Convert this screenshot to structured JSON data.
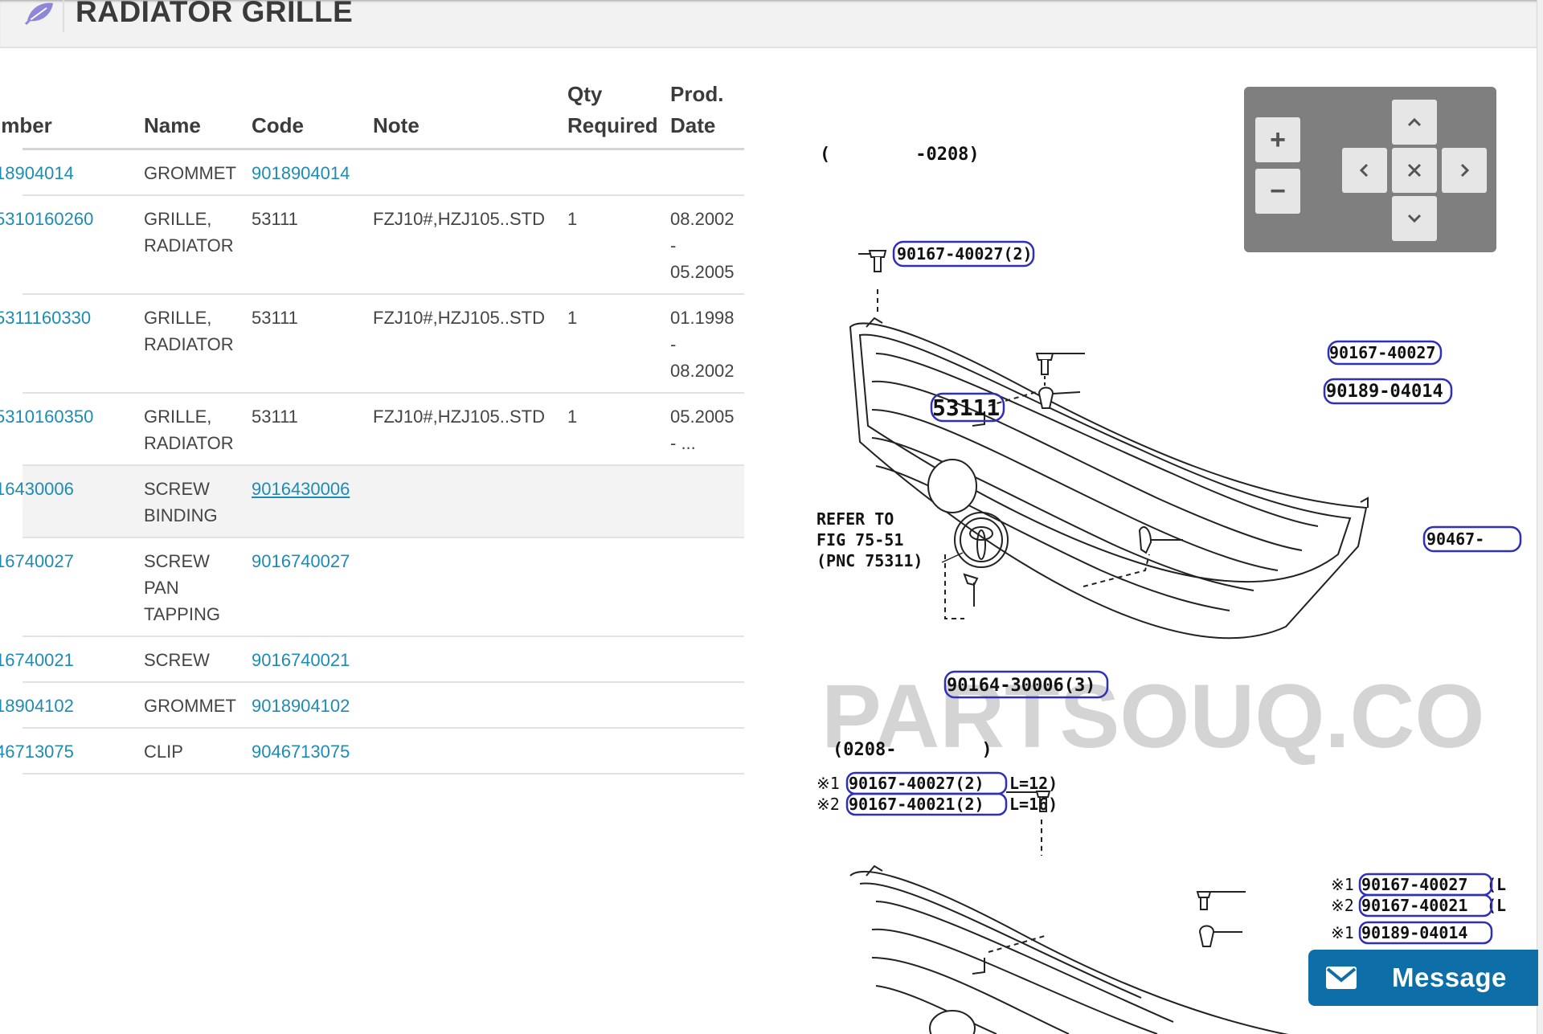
{
  "header": {
    "title": "RADIATOR GRILLE",
    "logo_icon": "leaf-logo-icon"
  },
  "table": {
    "headers": {
      "number": "ımber",
      "name": "Name",
      "code": "Code",
      "note": "Note",
      "qty_line1": "Qty",
      "qty_line2": "Required",
      "date_line1": "Prod.",
      "date_line2": "Date"
    },
    "rows": [
      {
        "number": "18904014",
        "name": [
          "GROMMET"
        ],
        "code": "9018904014",
        "code_is_link": true,
        "note": "",
        "qty": "",
        "date": []
      },
      {
        "number": "5310160260",
        "name": [
          "GRILLE,",
          "RADIATOR"
        ],
        "code": "53111",
        "code_is_link": false,
        "note": "FZJ10#,HZJ105..STD",
        "qty": "1",
        "date": [
          "08.2002",
          "-",
          "05.2005"
        ]
      },
      {
        "number": "5311160330",
        "name": [
          "GRILLE,",
          "RADIATOR"
        ],
        "code": "53111",
        "code_is_link": false,
        "note": "FZJ10#,HZJ105..STD",
        "qty": "1",
        "date": [
          "01.1998",
          "-",
          "08.2002"
        ]
      },
      {
        "number": "5310160350",
        "name": [
          "GRILLE,",
          "RADIATOR"
        ],
        "code": "53111",
        "code_is_link": false,
        "note": "FZJ10#,HZJ105..STD",
        "qty": "1",
        "date": [
          "05.2005",
          "- ..."
        ]
      },
      {
        "number": "16430006",
        "name": [
          "SCREW",
          "BINDING"
        ],
        "code": "9016430006",
        "code_is_link": true,
        "code_underlined": true,
        "highlighted": true,
        "note": "",
        "qty": "",
        "date": []
      },
      {
        "number": "16740027",
        "name": [
          "SCREW",
          "PAN",
          "TAPPING"
        ],
        "code": "9016740027",
        "code_is_link": true,
        "note": "",
        "qty": "",
        "date": []
      },
      {
        "number": "16740021",
        "name": [
          "SCREW"
        ],
        "code": "9016740021",
        "code_is_link": true,
        "note": "",
        "qty": "",
        "date": []
      },
      {
        "number": "18904102",
        "name": [
          "GROMMET"
        ],
        "code": "9018904102",
        "code_is_link": true,
        "note": "",
        "qty": "",
        "date": []
      },
      {
        "number": "46713075",
        "name": [
          "CLIP"
        ],
        "code": "9046713075",
        "code_is_link": true,
        "note": "",
        "qty": "",
        "date": []
      }
    ]
  },
  "diagram": {
    "range_top": "(        -0208)",
    "range_bottom": "(0208-        )",
    "labels": {
      "screw_top": "90167-40027(2)",
      "screw_right": "90167-40027",
      "grommet_right": "90189-04014",
      "grille": "53111",
      "clip_right": "90467-",
      "screw_bottom": "90164-30006(3)",
      "screw_b1": "90167-40027(2)",
      "screw_b1_suffix": "L=12)",
      "screw_b2": "90167-40021(2)",
      "screw_b2_suffix": "L=16)",
      "screw_b3": "90167-40027",
      "screw_b4": "90167-40021",
      "grommet_b": "90189-04014",
      "mark1": "※1",
      "mark2": "※2",
      "suffix_l": "(L",
      "refer_line1": "REFER TO",
      "refer_line2": "FIG 75-51",
      "refer_line3": "(PNC 75311)"
    },
    "watermark": "PARTSOUQ.CO"
  },
  "zoom": {
    "zoom_in": "+",
    "zoom_out": "−",
    "icons": [
      "chevron-up-icon",
      "chevron-left-icon",
      "close-icon",
      "chevron-right-icon",
      "chevron-down-icon"
    ]
  },
  "message_button": {
    "label": "Message",
    "icon": "mail-icon"
  },
  "colors": {
    "link": "#1d8cb5",
    "label_outline": "#2f2fb8",
    "message_bg": "#0e6ea8",
    "zoom_panel": "#7f7f7f"
  }
}
